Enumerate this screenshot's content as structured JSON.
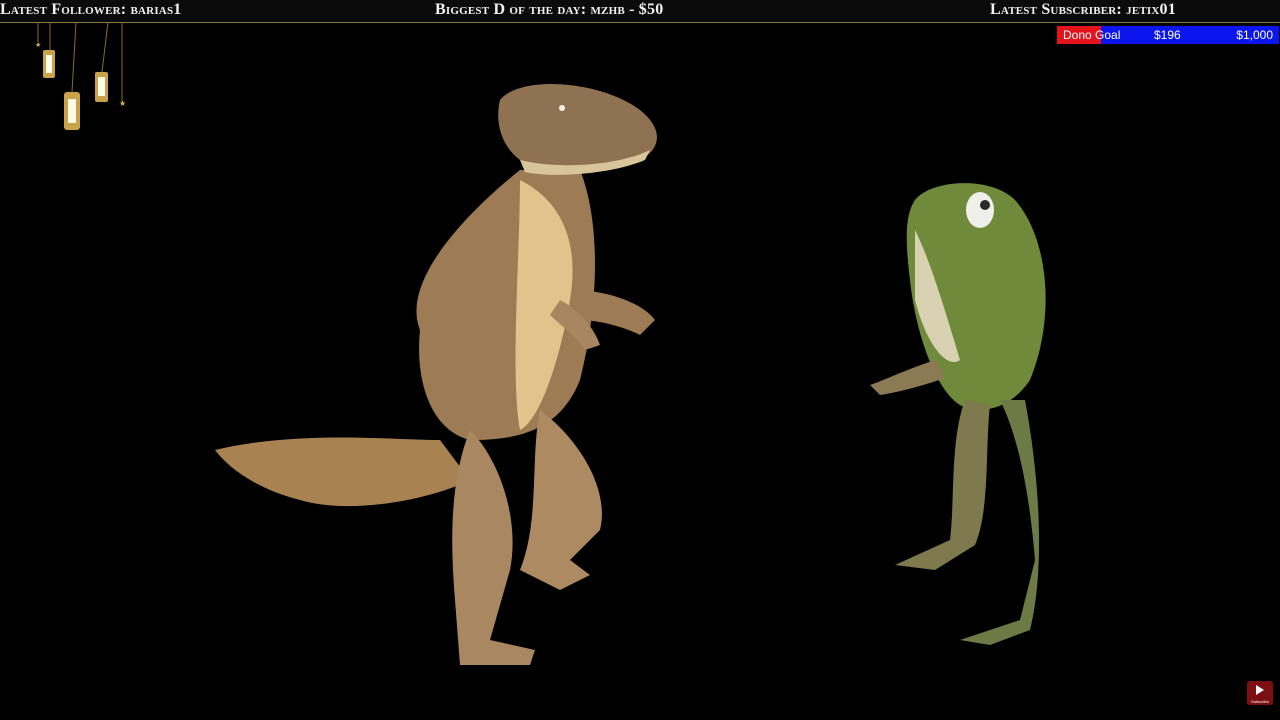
{
  "overlay": {
    "latest_follower": "Latest Follower: barias1",
    "biggest_dono": "Biggest D of the day: mzhb - $50",
    "latest_subscriber": "Latest Subscriber: jetix01"
  },
  "dono_goal": {
    "label": "Dono Goal",
    "current": "$196",
    "target": "$1,000",
    "progress_fraction": 0.196,
    "fill_color": "#e5131b",
    "bar_color": "#0b16ee"
  },
  "youtube_badge": {
    "icon": "youtube-subscribe-icon",
    "caption": "Subscribe"
  },
  "scene": {
    "characters": [
      "dinosaur-icon",
      "frog-icon"
    ],
    "decoration": "hanging-lanterns-icon"
  }
}
